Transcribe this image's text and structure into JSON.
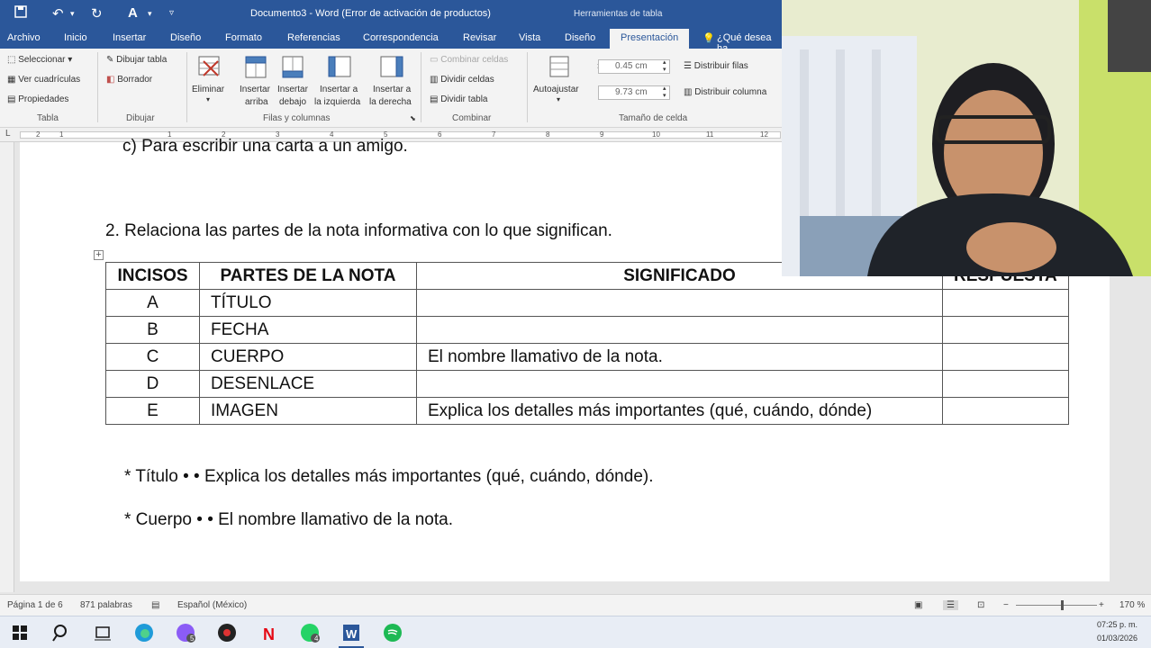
{
  "window": {
    "title": "Documento3 - Word (Error de activación de productos)",
    "context_label": "Herramientas de tabla"
  },
  "tabs": [
    "Archivo",
    "Inicio",
    "Insertar",
    "Diseño",
    "Formato",
    "Referencias",
    "Correspondencia",
    "Revisar",
    "Vista",
    "Diseño",
    "Presentación"
  ],
  "tell_me": "¿Qué desea ha",
  "ribbon": {
    "tabla": {
      "seleccionar": "Seleccionar",
      "ver_cuadriculas": "Ver cuadrículas",
      "propiedades": "Propiedades",
      "group": "Tabla"
    },
    "dibujar": {
      "dibujar_tabla": "Dibujar tabla",
      "borrador": "Borrador",
      "group": "Dibujar"
    },
    "filas": {
      "eliminar": "Eliminar",
      "insertar_arriba_1": "Insertar",
      "insertar_arriba_2": "arriba",
      "insertar_debajo_1": "Insertar",
      "insertar_debajo_2": "debajo",
      "insertar_izq_1": "Insertar a",
      "insertar_izq_2": "la izquierda",
      "insertar_der_1": "Insertar a",
      "insertar_der_2": "la derecha",
      "group": "Filas y columnas"
    },
    "combinar": {
      "combinar_celdas": "Combinar celdas",
      "dividir_celdas": "Dividir celdas",
      "dividir_tabla": "Dividir tabla",
      "group": "Combinar"
    },
    "tamano": {
      "autoajustar": "Autoajustar",
      "height": "0.45 cm",
      "width": "9.73 cm",
      "distribuir_filas": "Distribuir filas",
      "distribuir_columnas": "Distribuir columna",
      "group": "Tamaño de celda"
    }
  },
  "ruler_numbers": [
    "2",
    "1",
    "1",
    "2",
    "3",
    "4",
    "5",
    "6",
    "7",
    "8",
    "9",
    "10",
    "11",
    "12"
  ],
  "document": {
    "prev_line": "c) Para escribir una carta a un amigo.",
    "question": "2.  Relaciona las partes de la nota informativa con lo que significan.",
    "table": {
      "headers": [
        "INCISOS",
        "PARTES DE LA NOTA",
        "SIGNIFICADO",
        "RESPUESTA"
      ],
      "rows": [
        [
          "A",
          "TÍTULO",
          "",
          ""
        ],
        [
          "B",
          "FECHA",
          "",
          ""
        ],
        [
          "C",
          "CUERPO",
          "El nombre llamativo de la nota.",
          ""
        ],
        [
          "D",
          "DESENLACE",
          "",
          ""
        ],
        [
          "E",
          "IMAGEN",
          "Explica los detalles más importantes (qué, cuándo, dónde)",
          ""
        ]
      ]
    },
    "bullet1": "*   Título • • Explica los detalles más importantes (qué, cuándo, dónde).",
    "bullet2": "*   Cuerpo • • El nombre llamativo de la nota."
  },
  "status": {
    "page": "Página 1 de 6",
    "words": "871 palabras",
    "language": "Español (México)",
    "zoom": "170 %"
  },
  "tray": {
    "time": "07:25 p. m.",
    "date": "01/03/2026"
  },
  "taskbar_badges": {
    "edge": "",
    "messenger": "5",
    "whatsapp": "4"
  },
  "colors": {
    "word_blue": "#2b579a",
    "ribbon_bg": "#f3f3f3"
  }
}
